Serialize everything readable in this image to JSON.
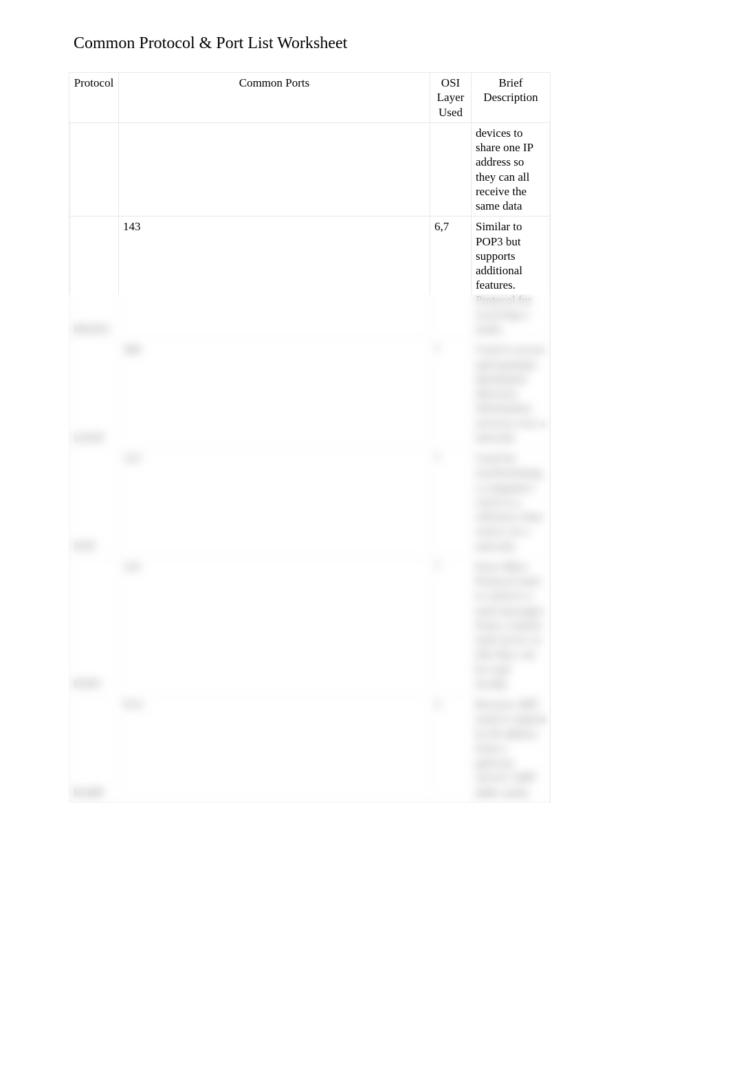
{
  "title": "Common Protocol & Port List Worksheet",
  "headers": {
    "protocol": "Protocol",
    "ports": "Common Ports",
    "osi": "OSI Layer Used",
    "desc": "Brief Description"
  },
  "rows": [
    {
      "protocol": "",
      "ports": "",
      "osi": "",
      "desc": "devices to share one IP address so they can all receive the same data"
    },
    {
      "protocol": "IMAP4",
      "ports": "143",
      "osi": "6,7",
      "desc": "Similar to POP3 but supports additional features. Protocol for receiving e-mails."
    },
    {
      "protocol": "LDAP",
      "ports": "389",
      "osi": "7",
      "desc": "Used to access and maintain distributed directory information services over a network."
    },
    {
      "protocol": "NTP",
      "ports": "123",
      "osi": "7",
      "desc": "Used for synchronizing a computer's clock to a reference time source on a network."
    },
    {
      "protocol": "POP3",
      "ports": "110",
      "osi": "7",
      "desc": "Post Office Protocol used to retrieve e-mail messages from a remote mail server so that they can be read locally."
    },
    {
      "protocol": "RARP",
      "ports": "N/A",
      "osi": "3",
      "desc": "Reverse ARP used to request its IP address from a gateway server's ARP table cache."
    }
  ]
}
